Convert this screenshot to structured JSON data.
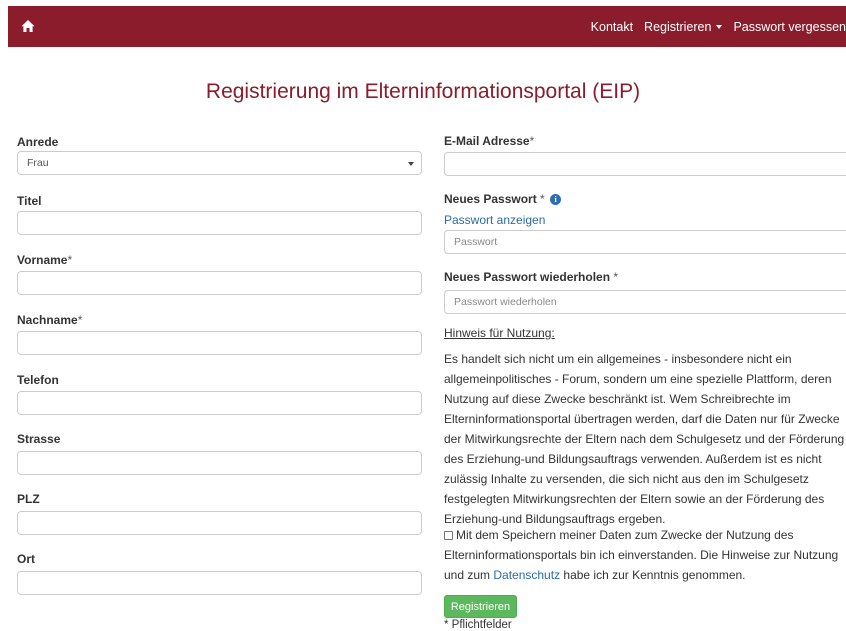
{
  "nav": {
    "home_icon": "home-icon",
    "contact": "Kontakt",
    "register": "Registrieren",
    "forgot_password": "Passwort vergessen"
  },
  "page_title": "Registrierung im Elterninformationsportal (EIP)",
  "form": {
    "salutation": {
      "label": "Anrede",
      "value": "Frau"
    },
    "title_field": {
      "label": "Titel",
      "value": ""
    },
    "first_name": {
      "label": "Vorname",
      "required_mark": "*",
      "value": ""
    },
    "last_name": {
      "label": "Nachname",
      "required_mark": "*",
      "value": ""
    },
    "phone": {
      "label": "Telefon",
      "value": ""
    },
    "street": {
      "label": "Strasse",
      "value": ""
    },
    "zip": {
      "label": "PLZ",
      "value": ""
    },
    "city": {
      "label": "Ort",
      "value": ""
    },
    "email": {
      "label": "E-Mail Adresse",
      "required_mark": "*",
      "value": ""
    },
    "new_password": {
      "label": "Neues Passwort",
      "required_mark": " *",
      "info_icon": "info-icon",
      "show_link": "Passwort anzeigen",
      "placeholder": "Passwort"
    },
    "repeat_password": {
      "label": "Neues Passwort wiederholen",
      "required_mark": " *",
      "placeholder": "Passwort wiederholen"
    }
  },
  "hint": {
    "title": "Hinweis für Nutzung:",
    "text": "Es handelt sich nicht um ein allgemeines - insbesondere nicht ein allgemeinpolitisches - Forum, sondern um eine spezielle Plattform, deren Nutzung auf diese Zwecke beschränkt ist. Wem Schreibrechte im Elterninformationsportal übertragen werden, darf die Daten nur für Zwecke der Mitwirkungsrechte der Eltern nach dem Schulgesetz und der Förderung des Erziehung-und Bildungsauftrags verwenden. Außerdem ist es nicht zulässig Inhalte zu versenden, die sich nicht aus den im Schulgesetz festgelegten Mitwirkungsrechten der Eltern sowie an der Förderung des Erziehung-und Bildungsauftrags ergeben."
  },
  "consent": {
    "checked": false,
    "text_before": "Mit dem Speichern meiner Daten zum Zwecke der Nutzung des Elterninformationsportals bin ich einverstanden. Die Hinweise zur Nutzung und zum ",
    "link": "Datenschutz",
    "text_after": " habe ich zur Kenntnis genommen."
  },
  "submit_label": "Registrieren",
  "required_note": "* Pflichtfelder",
  "colors": {
    "brand": "#8a1c2c",
    "link": "#2a6ba8",
    "button": "#5cb85c"
  }
}
